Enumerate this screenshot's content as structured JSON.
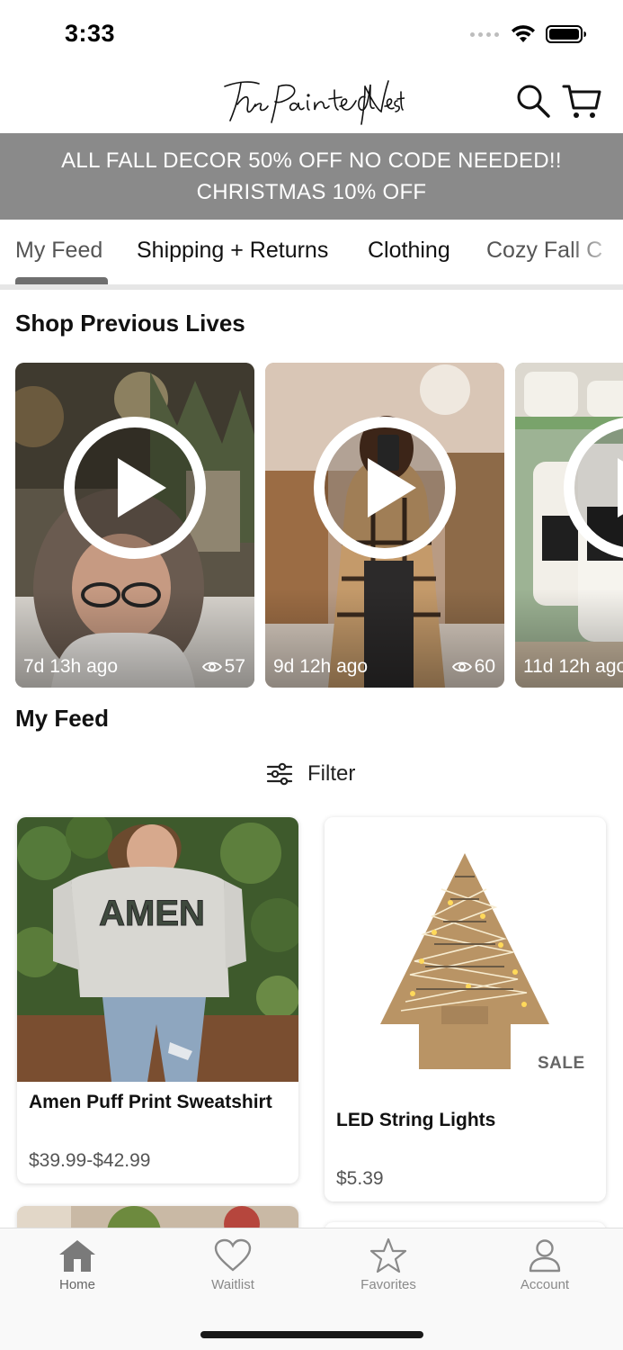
{
  "status_bar": {
    "time": "3:33",
    "icons": [
      "signal-icon",
      "wifi-icon",
      "battery-icon"
    ]
  },
  "header": {
    "logo_text": "The Painted Nest",
    "icons": [
      "search-icon",
      "cart-icon"
    ]
  },
  "promo": {
    "line1": "ALL FALL DECOR 50% OFF NO CODE NEEDED!!",
    "line2": "CHRISTMAS 10% OFF",
    "background": "#8a8a8a"
  },
  "tabs": [
    {
      "label": "My Feed",
      "active": true
    },
    {
      "label": "Shipping + Returns",
      "active": false
    },
    {
      "label": "Clothing",
      "active": false
    },
    {
      "label": "Cozy Fall C",
      "active": false
    }
  ],
  "previous_lives": {
    "title": "Shop Previous Lives",
    "videos": [
      {
        "age": "7d 13h ago",
        "views": "57"
      },
      {
        "age": "9d 12h ago",
        "views": "60"
      },
      {
        "age": "11d 12h ago",
        "views": ""
      }
    ]
  },
  "feed": {
    "title": "My Feed",
    "filter_label": "Filter",
    "products": [
      {
        "name": "Amen Puff Print Sweatshirt",
        "price": "$39.99-$42.99",
        "badge": "",
        "print_text": "AMEN"
      },
      {
        "name": "LED String Lights",
        "price": "$5.39",
        "badge": "SALE"
      }
    ]
  },
  "bottom_nav": [
    {
      "label": "Home",
      "icon": "home-icon",
      "active": true
    },
    {
      "label": "Waitlist",
      "icon": "heart-icon",
      "active": false
    },
    {
      "label": "Favorites",
      "icon": "star-icon",
      "active": false
    },
    {
      "label": "Account",
      "icon": "account-icon",
      "active": false
    }
  ],
  "colors": {
    "promo_bg": "#8a8a8a",
    "tab_indicator": "#6f6f6f",
    "text": "#111111",
    "muted": "#8a8a8a"
  }
}
